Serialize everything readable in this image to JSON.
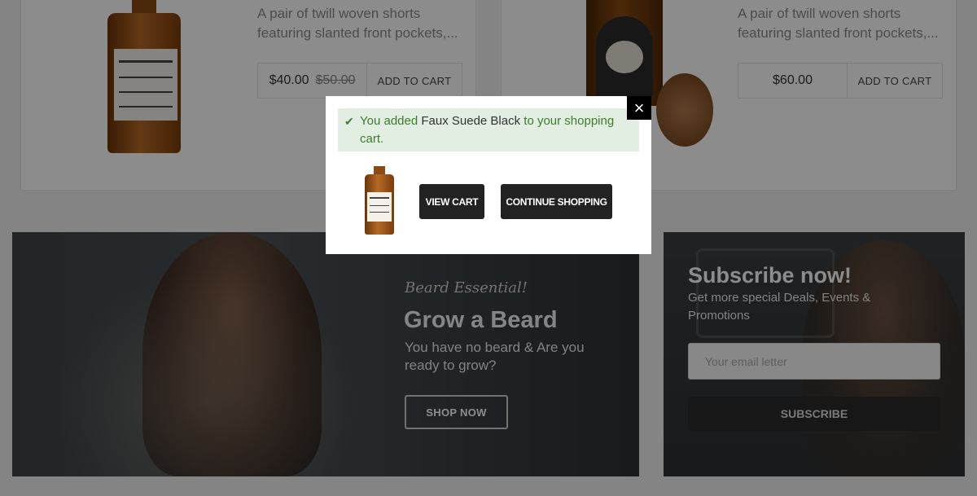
{
  "products": [
    {
      "description": "A pair of twill woven shorts featuring slanted front pockets,...",
      "price": "$40.00",
      "old_price": "$50.00",
      "add_label": "ADD TO CART"
    },
    {
      "description": "A pair of twill woven shorts featuring slanted front pockets,...",
      "price": "$60.00",
      "add_label": "ADD TO CART"
    }
  ],
  "banner": {
    "script": "Beard Essential!",
    "title": "Grow a Beard",
    "subtitle": "You have no beard & Are you ready to grow?",
    "button": "SHOP NOW"
  },
  "subscribe": {
    "title": "Subscribe now!",
    "subtitle": "Get more special Deals, Events & Promotions",
    "placeholder": "Your email letter",
    "button": "SUBSCRIBE"
  },
  "modal": {
    "message_prefix": "You added ",
    "product_name": "Faux Suede Black",
    "message_suffix": " to your shopping cart.",
    "view_cart": "VIEW CART",
    "continue": "CONTINUE SHOPPING",
    "close_icon": "×"
  },
  "colors": {
    "success_bg": "#e3eee3",
    "success_text": "#3c7d2b",
    "button_dark": "#222222"
  }
}
